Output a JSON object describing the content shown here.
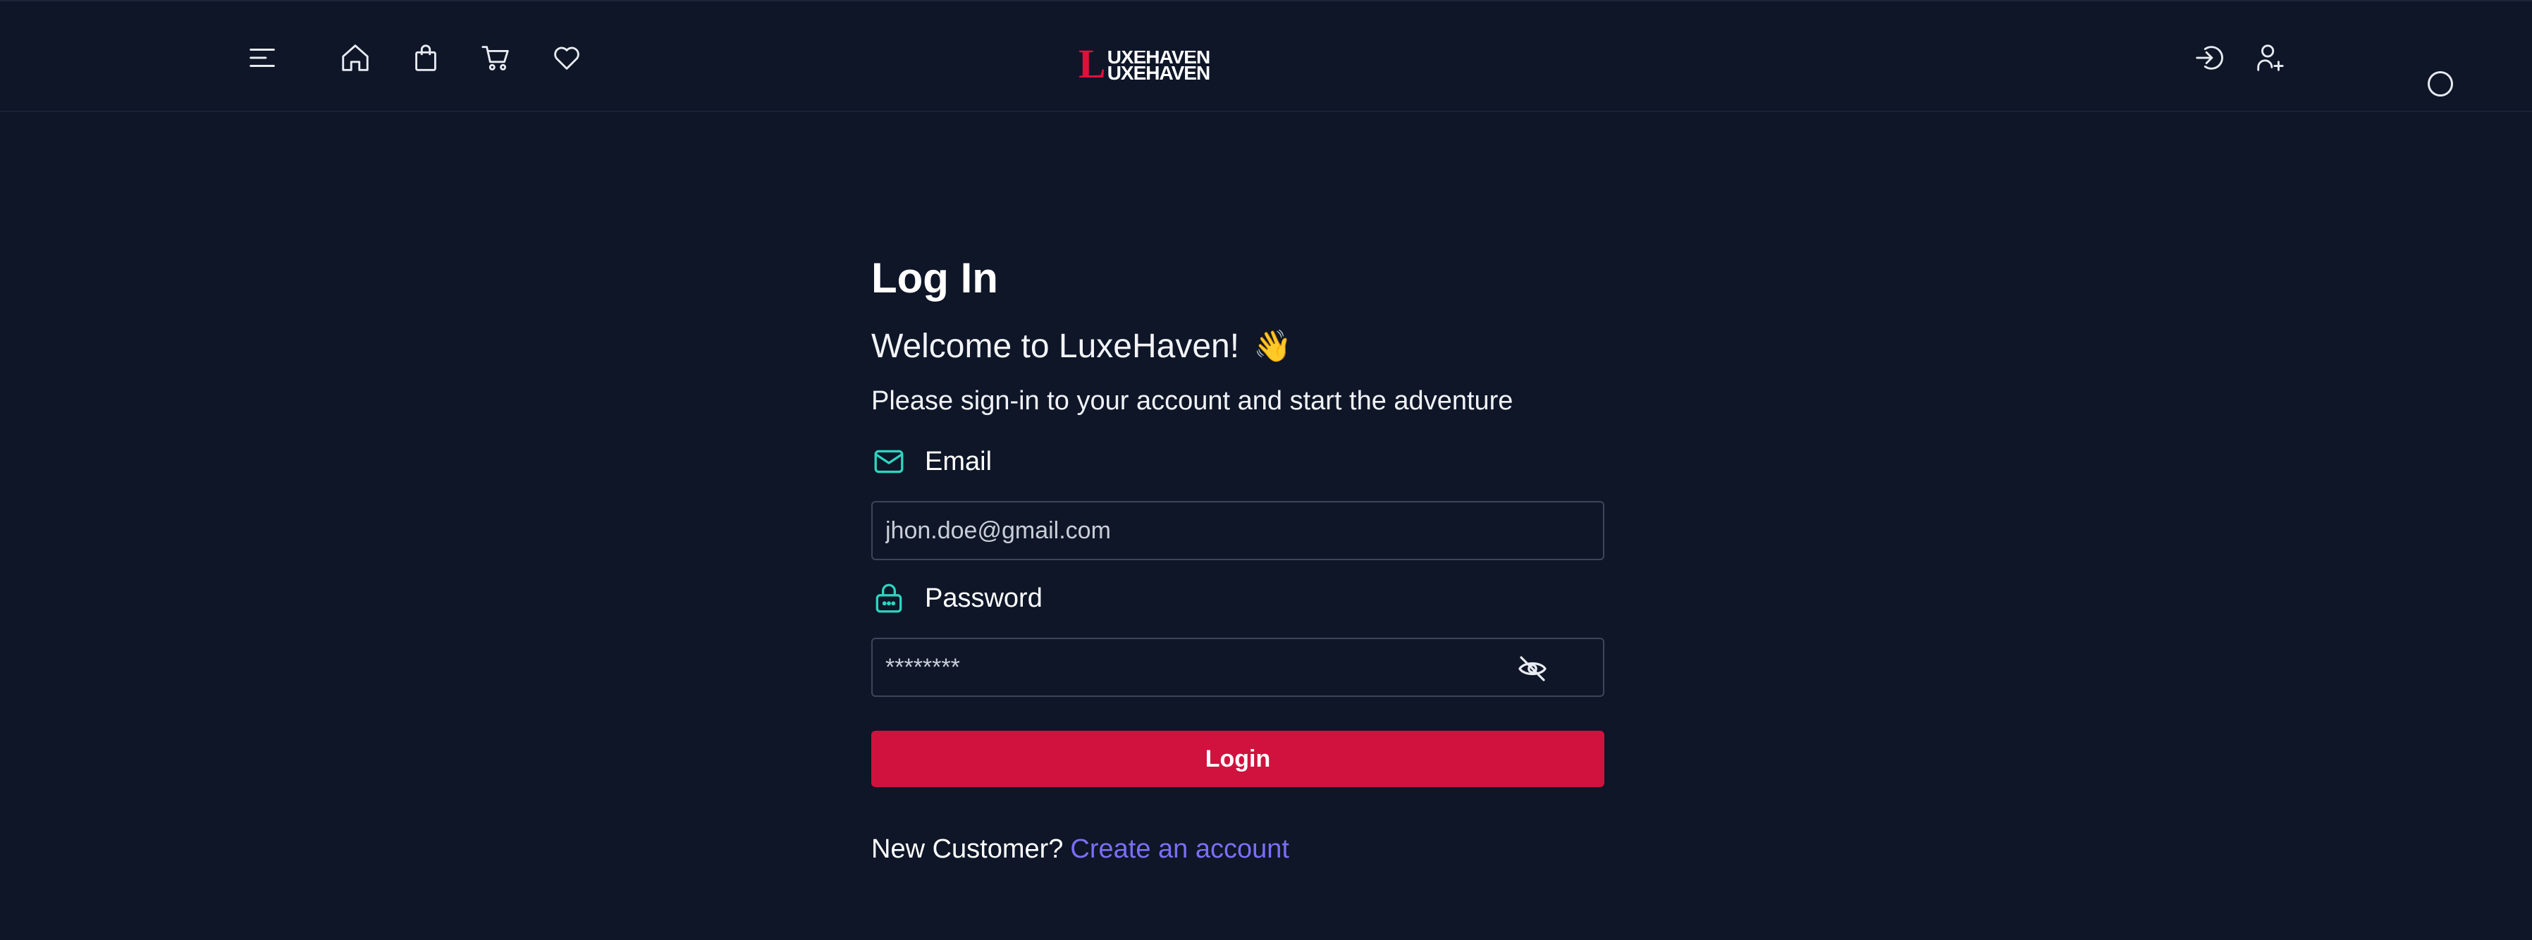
{
  "navbar": {
    "icons": [
      "menu-icon",
      "home-icon",
      "shopping-bag-icon",
      "cart-icon",
      "heart-icon",
      "login-icon",
      "add-user-icon"
    ],
    "logo_letter": "L",
    "logo_top": "UXEHAVEN",
    "logo_bottom": "UXEHAVEN"
  },
  "form": {
    "title": "Log In",
    "welcome": "Welcome to LuxeHaven!",
    "wave_emoji": "👋",
    "subtitle": "Please sign-in to your account and start the adventure",
    "email_label": "Email",
    "email_placeholder": "jhon.doe@gmail.com",
    "password_label": "Password",
    "password_placeholder": "********",
    "login_label": "Login",
    "new_customer_text": "New Customer?",
    "create_account_link": "Create an account"
  },
  "colors": {
    "background": "#0e1628",
    "accent": "#d1113e",
    "link": "#7b6ef6",
    "icon_teal": "#2dd4bf"
  }
}
